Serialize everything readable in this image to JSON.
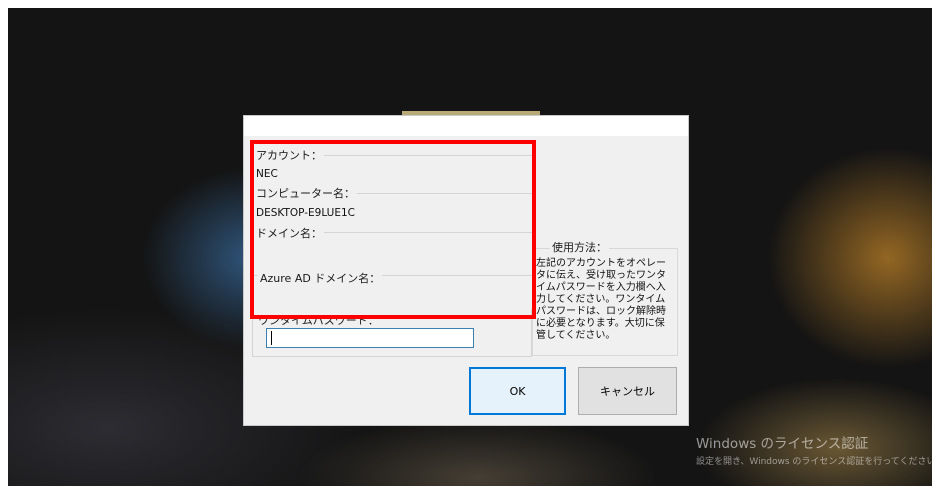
{
  "account": {
    "label": "アカウント：",
    "value": "NEC"
  },
  "computer": {
    "label": "コンピューター名：",
    "value": "DESKTOP-E9LUE1C"
  },
  "domain": {
    "label": "ドメイン名：",
    "value": ""
  },
  "azure_domain": {
    "label": "Azure AD ドメイン名：",
    "value": ""
  },
  "otp": {
    "label": "ワンタイムパスワード：",
    "value": ""
  },
  "usage": {
    "label": "使用方法：",
    "text": "左記のアカウントをオペレータに伝え、受け取ったワンタイムパスワードを入力欄へ入力してください。ワンタイムパスワードは、ロック解除時に必要となります。大切に保管してください。"
  },
  "buttons": {
    "ok": "OK",
    "cancel": "キャンセル"
  },
  "watermark": {
    "title": "Windows のライセンス認証",
    "subtitle": "設定を開き、Windows のライセンス認証を行ってください。"
  },
  "colors": {
    "highlight": "#ff0000",
    "ok_border": "#0078d7",
    "dialog_bg": "#f0f0f0"
  }
}
